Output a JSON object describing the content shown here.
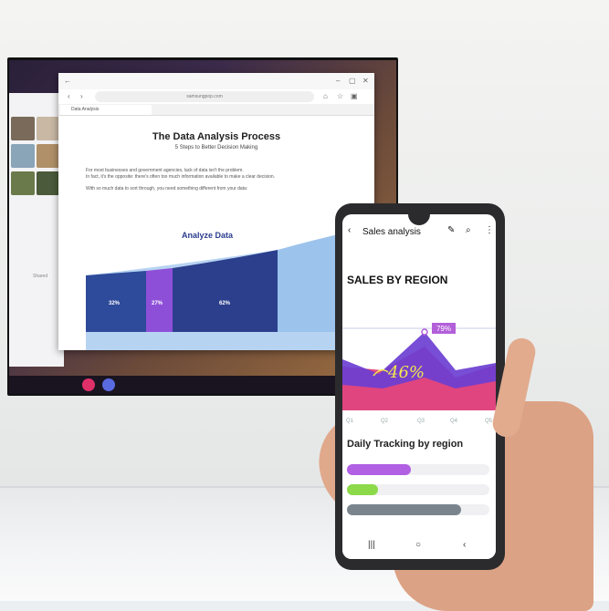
{
  "tv": {
    "browser": {
      "address": "samsungpop.com",
      "tab_label": "Data Analysis",
      "doc_title": "The Data Analysis Process",
      "doc_subtitle": "5 Steps to Better Decision Making",
      "paragraph_1": "For most businesses and government agencies, lack of data isn't the problem.",
      "paragraph_2": "In fact, it's the opposite: there's often too much information available to make a clear decision.",
      "paragraph_3": "With so much data to sort through, you need something different from your data:",
      "section_title": "Analyze Data",
      "bars": [
        {
          "label": "32%",
          "color": "#2e4a9a"
        },
        {
          "label": "27%",
          "color": "#8e4fd8"
        },
        {
          "label": "62%",
          "color": "#2b3f8c"
        }
      ]
    },
    "left_app_label": "Shared"
  },
  "phone": {
    "title": "Sales analysis",
    "chart_heading": "SALES BY REGION",
    "peak_badge": "79%",
    "handwritten": "46%",
    "x_labels": [
      "Q1",
      "Q2",
      "Q3",
      "Q4",
      "Q5"
    ],
    "daily_heading": "Daily Tracking by region",
    "tracks": [
      {
        "fraction": 0.45,
        "color": "#b15fe3"
      },
      {
        "fraction": 0.22,
        "color": "#8cd94a"
      },
      {
        "fraction": 0.8,
        "color": "#7a848d"
      }
    ],
    "colors": {
      "area_pink": "#e0457f",
      "area_purple": "#6b3fd1",
      "badge": "#b25fd9",
      "annotation": "#f4e94e"
    }
  }
}
